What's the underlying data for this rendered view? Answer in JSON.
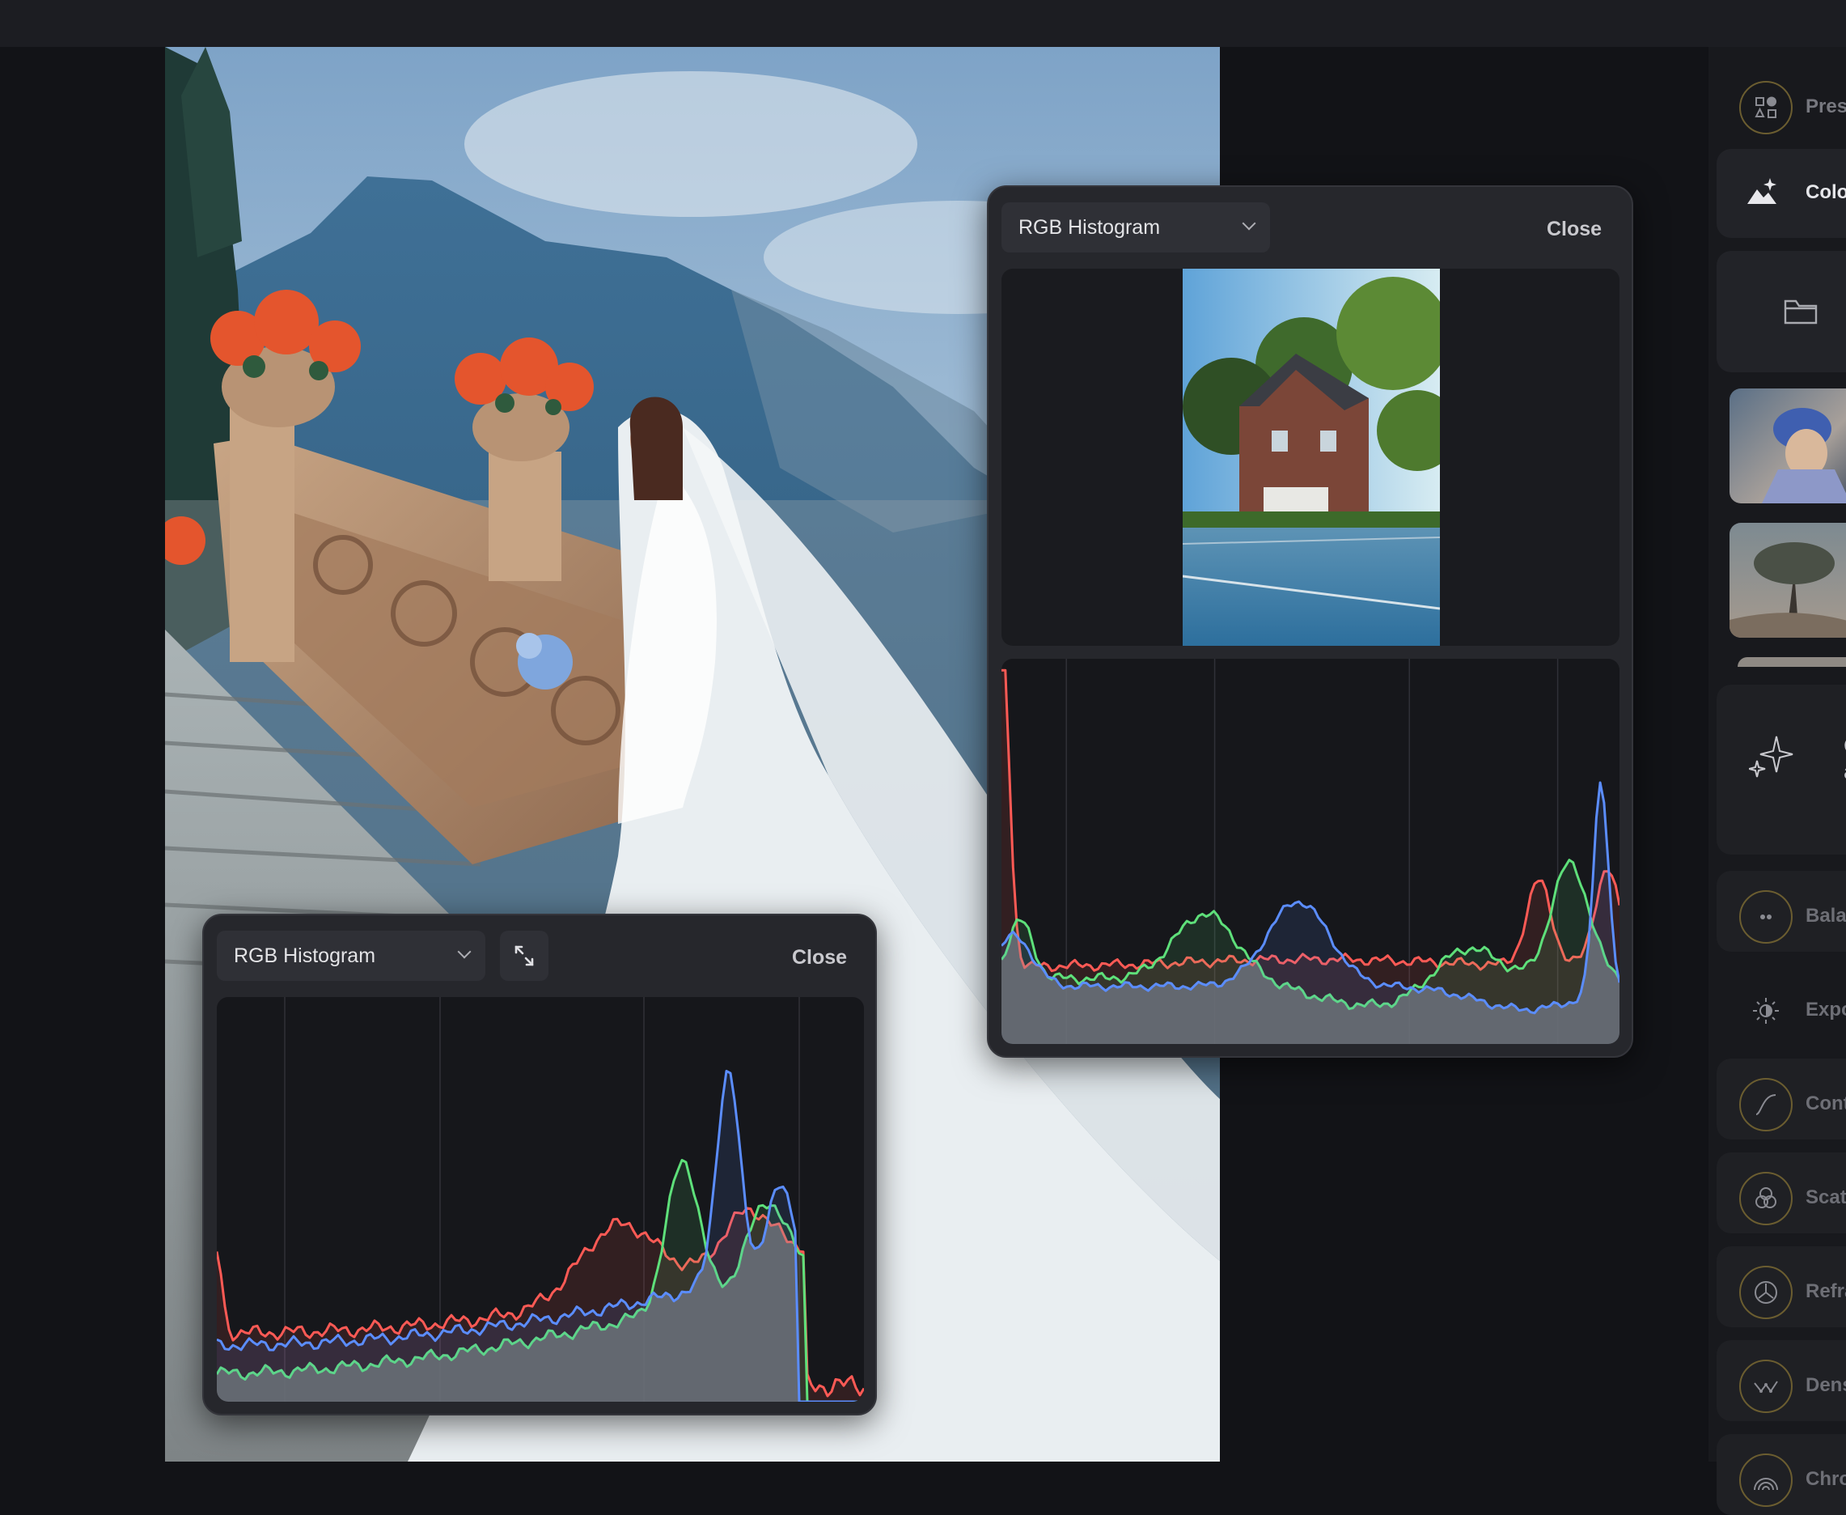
{
  "histogram_right": {
    "mode_label": "RGB Histogram",
    "close_label": "Close"
  },
  "histogram_left": {
    "mode_label": "RGB Histogram",
    "close_label": "Close"
  },
  "sidebar": {
    "items": [
      {
        "label": "Prese",
        "icon": "presets-icon"
      },
      {
        "label": "Color",
        "icon": "color-sparkle-icon"
      },
      {
        "label": "Balar",
        "icon": "balance-icon"
      },
      {
        "label": "Expo",
        "icon": "exposure-icon"
      },
      {
        "label": "Cont",
        "icon": "contrast-curve-icon"
      },
      {
        "label": "Scatt",
        "icon": "scatter-icon"
      },
      {
        "label": "Refra",
        "icon": "refraction-icon"
      },
      {
        "label": "Dens",
        "icon": "density-icon"
      },
      {
        "label": "Chro",
        "icon": "chroma-icon"
      }
    ],
    "ai_text_line1": "C",
    "ai_text_line2": "a"
  },
  "colors": {
    "red": "#ff5a55",
    "green": "#5ee07a",
    "blue": "#5b8dff",
    "gold_ring": "#6b5d30"
  }
}
